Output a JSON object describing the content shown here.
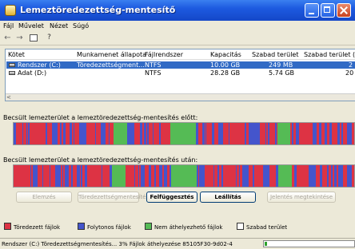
{
  "window": {
    "title": "Lemeztöredezettség-mentesítő"
  },
  "menu": [
    "Fájl",
    "Művelet",
    "Nézet",
    "Súgó"
  ],
  "toolbar": {
    "back": "←",
    "forward": "→",
    "help": "?"
  },
  "volumes": {
    "headers": [
      "Kötet",
      "Munkamenet állapota",
      "Fájlrendszer",
      "Kapacitás",
      "Szabad terület",
      "Szabad terület ("
    ],
    "rows": [
      {
        "volume": "Rendszer (C:)",
        "status": "Töredezettségment...",
        "fs": "NTFS",
        "capacity": "10.00 GB",
        "free": "249 MB",
        "free_pct": "2"
      },
      {
        "volume": "Adat (D:)",
        "status": "",
        "fs": "NTFS",
        "capacity": "28.28 GB",
        "free": "5.74 GB",
        "free_pct": "20"
      }
    ],
    "scroll_left": "<"
  },
  "sections": {
    "before_label": "Becsült lemezterület a lemeztöredezettség-mentesítés előtt:",
    "after_label": "Becsült lemezterület a lemeztöredezettség-mentesítés után:"
  },
  "map_colors": {
    "fragmented": "#dd3344",
    "contiguous": "#4455cc",
    "unmovable": "#55bb55",
    "free": "#ffffff"
  },
  "buttons": [
    {
      "label": "Elemzés",
      "enabled": false
    },
    {
      "label": "Töredezettségmentesítés",
      "enabled": false
    },
    {
      "label": "Felfüggesztés",
      "enabled": true
    },
    {
      "label": "Leállítás",
      "enabled": true
    },
    {
      "label": "Jelentés megtekintése",
      "enabled": false
    }
  ],
  "legend": [
    {
      "label": "Töredezett fájlok",
      "color": "#dd3344"
    },
    {
      "label": "Folytonos fájlok",
      "color": "#4455cc"
    },
    {
      "label": "Nem áthelyezhető fájlok",
      "color": "#55bb55"
    },
    {
      "label": "Szabad terület",
      "color": "#ffffff"
    }
  ],
  "status": {
    "text": "Rendszer (C:) Töredezettségmentesítés... 3%  Fájlok áthelyezése 85105F30-9d02-4",
    "progress": 0.03
  }
}
